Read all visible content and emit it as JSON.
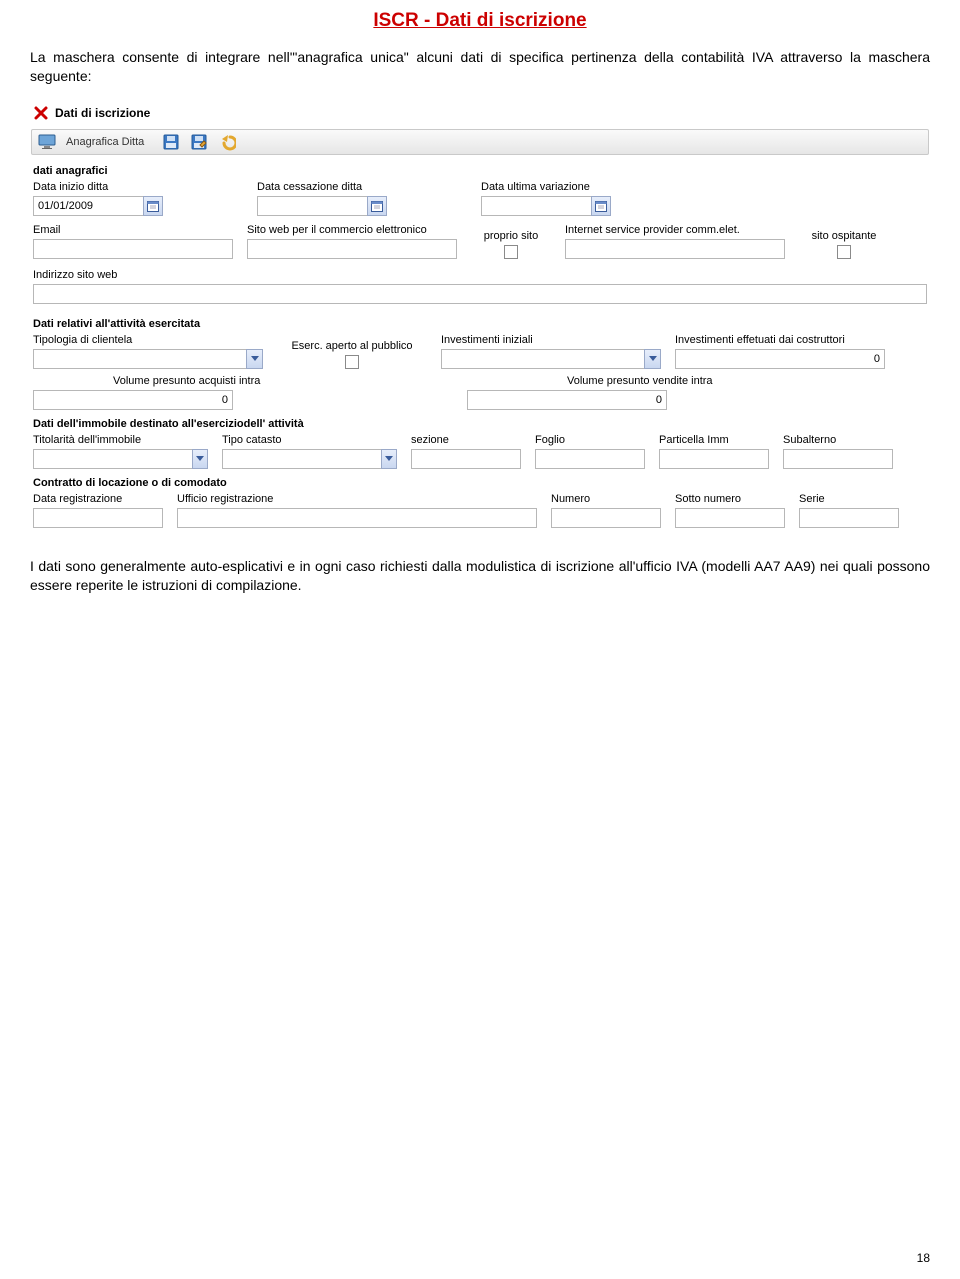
{
  "title": "ISCR - Dati di iscrizione",
  "intro": "La maschera consente di integrare nell'\"anagrafica unica\" alcuni dati di specifica pertinenza della contabilità IVA attraverso la maschera seguente:",
  "form": {
    "header": "Dati di iscrizione",
    "toolbar": {
      "label": "Anagrafica Ditta"
    },
    "sections": {
      "anagrafici": {
        "title": "dati anagrafici",
        "data_inizio_label": "Data inizio ditta",
        "data_inizio_value": "01/01/2009",
        "data_cess_label": "Data cessazione ditta",
        "data_cess_value": "",
        "data_var_label": "Data ultima variazione",
        "data_var_value": "",
        "email_label": "Email",
        "email_value": "",
        "sito_comm_label": "Sito web per il commercio elettronico",
        "sito_comm_value": "",
        "proprio_sito_label": "proprio sito",
        "isp_label": "Internet service provider comm.elet.",
        "isp_value": "",
        "sito_osp_label": "sito ospitante",
        "indirizzo_sito_label": "Indirizzo sito web",
        "indirizzo_sito_value": ""
      },
      "attivita": {
        "title": "Dati relativi all'attività esercitata",
        "tip_clientela_label": "Tipologia di clientela",
        "tip_clientela_value": "",
        "eserc_pubb_label": "Eserc. aperto al pubblico",
        "inv_iniz_label": "Investimenti iniziali",
        "inv_iniz_value": "",
        "inv_costr_label": "Investimenti effetuati dai costruttori",
        "inv_costr_value": "0",
        "vol_acq_label": "Volume presunto acquisti intra",
        "vol_acq_value": "0",
        "vol_vend_label": "Volume presunto vendite intra",
        "vol_vend_value": "0"
      },
      "immobile": {
        "title": "Dati dell'immobile destinato all'eserciziodell' attività",
        "titolarita_label": "Titolarità dell'immobile",
        "titolarita_value": "",
        "tipo_catasto_label": "Tipo catasto",
        "tipo_catasto_value": "",
        "sezione_label": "sezione",
        "sezione_value": "",
        "foglio_label": "Foglio",
        "foglio_value": "",
        "particella_label": "Particella Imm",
        "particella_value": "",
        "subalterno_label": "Subalterno",
        "subalterno_value": ""
      },
      "contratto": {
        "title": "Contratto di locazione o di comodato",
        "data_reg_label": "Data registrazione",
        "data_reg_value": "",
        "ufficio_label": "Ufficio registrazione",
        "ufficio_value": "",
        "numero_label": "Numero",
        "numero_value": "",
        "sotto_label": "Sotto numero",
        "sotto_value": "",
        "serie_label": "Serie",
        "serie_value": ""
      }
    }
  },
  "outro": "I dati sono generalmente auto-esplicativi e in ogni caso richiesti dalla modulistica di iscrizione all'ufficio IVA (modelli AA7 AA9) nei quali possono essere reperite le istruzioni di compilazione.",
  "page_no": "18"
}
